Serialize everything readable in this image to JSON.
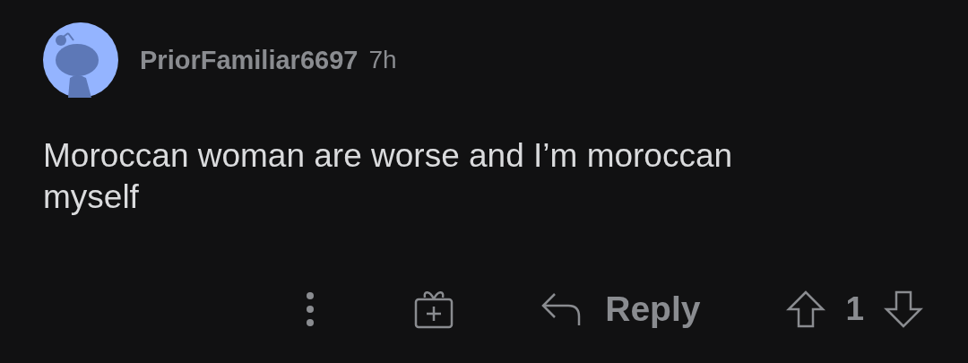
{
  "comment": {
    "author": "PriorFamiliar6697",
    "time": "7h",
    "body": "Moroccan woman are worse and I’m moroccan myself",
    "actions": {
      "reply": "Reply",
      "score": "1"
    }
  }
}
